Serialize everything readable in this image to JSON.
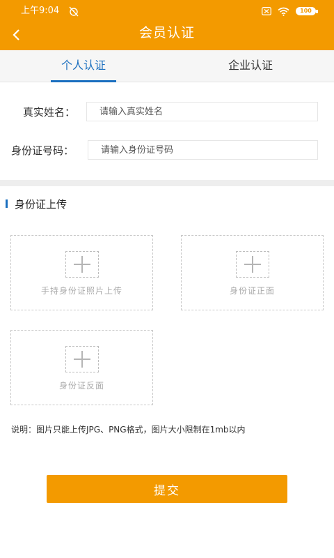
{
  "status_bar": {
    "time": "上午9:04",
    "battery": "100",
    "icons": [
      "alarm-off-icon",
      "sim-off-icon",
      "wifi-icon",
      "battery-icon"
    ]
  },
  "nav": {
    "title": "会员认证",
    "back_icon": "chevron-left-icon"
  },
  "tabs": [
    {
      "label": "个人认证",
      "active": true
    },
    {
      "label": "企业认证",
      "active": false
    }
  ],
  "form": {
    "name": {
      "label": "真实姓名：",
      "placeholder": "请输入真实姓名",
      "value": ""
    },
    "id_number": {
      "label": "身份证号码：",
      "placeholder": "请输入身份证号码",
      "value": ""
    }
  },
  "upload_section": {
    "title": "身份证上传",
    "boxes": [
      {
        "label": "手持身份证照片上传"
      },
      {
        "label": "身份证正面"
      },
      {
        "label": "身份证反面"
      }
    ],
    "note": "说明：图片只能上传JPG、PNG格式，图片大小限制在1mb以内"
  },
  "submit_label": "提交",
  "colors": {
    "brand": "#f39a00",
    "accent": "#1a6fbf",
    "divider": "#eeeeee"
  }
}
